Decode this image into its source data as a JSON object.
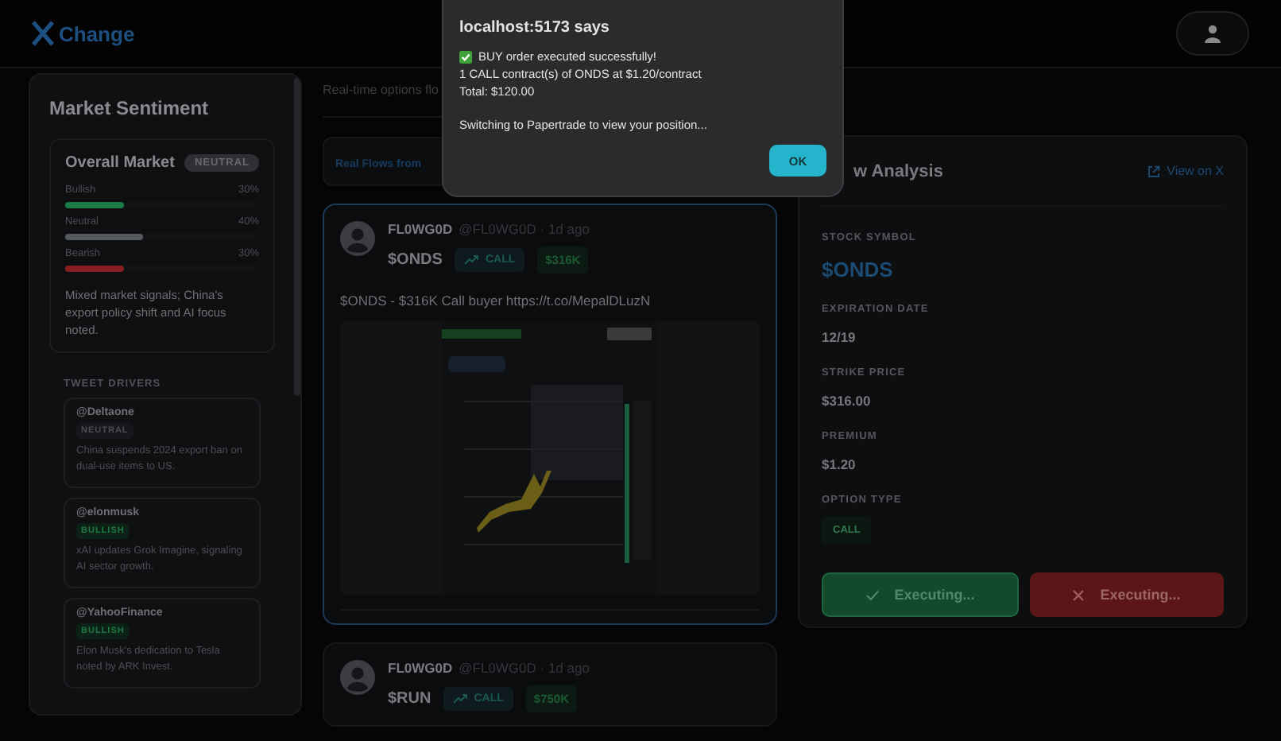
{
  "header": {
    "logo_text": "Change"
  },
  "sentiment": {
    "title": "Market Sentiment",
    "overall": {
      "title": "Overall Market",
      "badge": "NEUTRAL",
      "bars": [
        {
          "label": "Bullish",
          "value": "30%",
          "level": 0.3,
          "color": "#1c7a45"
        },
        {
          "label": "Neutral",
          "value": "40%",
          "level": 0.4,
          "color": "#55585e"
        },
        {
          "label": "Bearish",
          "value": "30%",
          "level": 0.3,
          "color": "#8a1d22"
        }
      ],
      "summary": "Mixed market signals; China's export policy shift and AI focus noted."
    },
    "drivers_heading": "TWEET DRIVERS",
    "drivers": [
      {
        "handle": "@Deltaone",
        "sentiment": "NEUTRAL",
        "kind": "neutral",
        "text": "China suspends 2024 export ban on dual-use items to US."
      },
      {
        "handle": "@elonmusk",
        "sentiment": "BULLISH",
        "kind": "bullish",
        "text": "xAI updates Grok Imagine, signaling AI sector growth."
      },
      {
        "handle": "@YahooFinance",
        "sentiment": "BULLISH",
        "kind": "bullish",
        "text": "Elon Musk's dedication to Tesla noted by ARK Invest."
      }
    ]
  },
  "feed": {
    "subtitle": "Real-time options flo",
    "filter_button": "Real Flows from",
    "posts": [
      {
        "name": "FL0WG0D",
        "handle": "@FL0WG0D · 1d ago",
        "ticker": "$ONDS",
        "type": "CALL",
        "amount": "$316K",
        "text": "$ONDS - $316K Call buyer https://t.co/MepalDLuzN",
        "selected": true
      },
      {
        "name": "FL0WG0D",
        "handle": "@FL0WG0D · 1d ago",
        "ticker": "$RUN",
        "type": "CALL",
        "amount": "$750K",
        "selected": false
      }
    ]
  },
  "analysis": {
    "title": "w Analysis",
    "link": "View on X",
    "fields": [
      {
        "label": "STOCK SYMBOL",
        "value": "$ONDS",
        "kind": "symbol"
      },
      {
        "label": "EXPIRATION DATE",
        "value": "12/19",
        "kind": "text"
      },
      {
        "label": "STRIKE PRICE",
        "value": "$316.00",
        "kind": "text"
      },
      {
        "label": "PREMIUM",
        "value": "$1.20",
        "kind": "text"
      },
      {
        "label": "OPTION TYPE",
        "value": "CALL",
        "kind": "badge"
      }
    ],
    "buttons": [
      {
        "label": "Executing...",
        "kind": "buy"
      },
      {
        "label": "Executing...",
        "kind": "sell"
      }
    ]
  },
  "dialog": {
    "title": "localhost:5173 says",
    "lines": [
      {
        "kind": "success",
        "text": "BUY order executed successfully!"
      },
      {
        "kind": "plain",
        "text": "1 CALL contract(s) of ONDS at $1.20/contract"
      },
      {
        "kind": "plain",
        "text": "Total: $120.00"
      }
    ],
    "note": "Switching to Papertrade to view your position...",
    "button": "OK"
  }
}
